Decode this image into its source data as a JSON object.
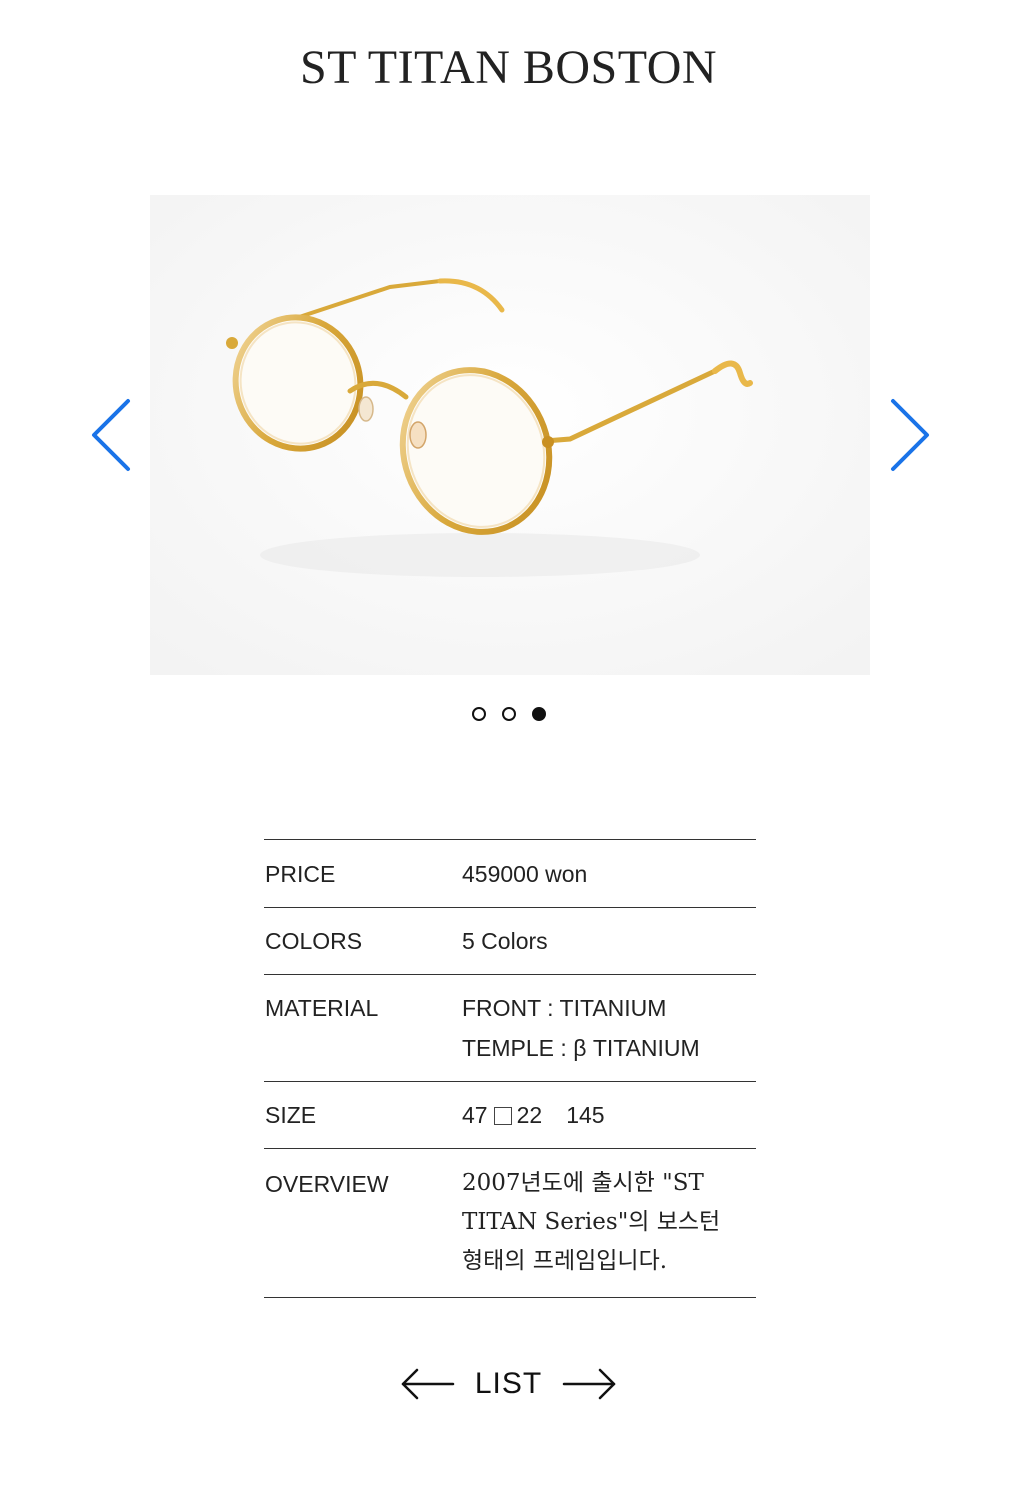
{
  "product": {
    "title": "ST TITAN BOSTON"
  },
  "carousel": {
    "slide_count": 3,
    "active_index": 2,
    "image_subject": "gold round titanium eyeglasses",
    "colors": {
      "frame_gold": "#d9a93a",
      "frame_light": "#f2d9a8",
      "arrow_blue": "#1a73e8"
    }
  },
  "specs": {
    "price": {
      "label": "PRICE",
      "value": "459000 won"
    },
    "colors": {
      "label": "COLORS",
      "value": "5 Colors"
    },
    "material": {
      "label": "MATERIAL",
      "front": "FRONT : TITANIUM",
      "temple": "TEMPLE : β TITANIUM"
    },
    "size": {
      "label": "SIZE",
      "lens": "47",
      "bridge": "22",
      "temple": "145"
    },
    "overview": {
      "label": "OVERVIEW",
      "text": "2007년도에 출시한 \"ST TITAN Series\"의 보스턴 형태의 프레임입니다."
    }
  },
  "list_nav": {
    "label": "LIST"
  }
}
